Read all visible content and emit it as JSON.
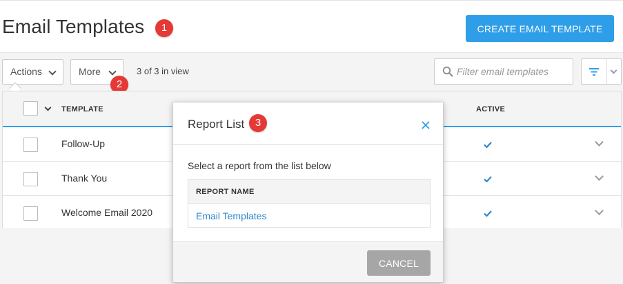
{
  "header": {
    "title": "Email Templates",
    "create_label": "CREATE EMAIL TEMPLATE"
  },
  "badges": [
    "1",
    "2",
    "3"
  ],
  "toolbar": {
    "actions_label": "Actions",
    "more_label": "More",
    "count_text": "3 of 3 in view",
    "search_placeholder": "Filter email templates"
  },
  "table": {
    "columns": {
      "template": "TEMPLATE",
      "active": "ACTIVE"
    },
    "rows": [
      {
        "name": "Follow-Up",
        "active": true
      },
      {
        "name": "Thank You",
        "active": true
      },
      {
        "name": "Welcome Email 2020",
        "active": true
      }
    ]
  },
  "modal": {
    "title": "Report List",
    "description": "Select a report from the list below",
    "column_header": "REPORT NAME",
    "reports": [
      "Email Templates"
    ],
    "cancel_label": "CANCEL"
  },
  "colors": {
    "accent": "#2f9ee8",
    "badge": "#e53935",
    "link": "#2f86cc",
    "cancel": "#a6a6a6"
  }
}
